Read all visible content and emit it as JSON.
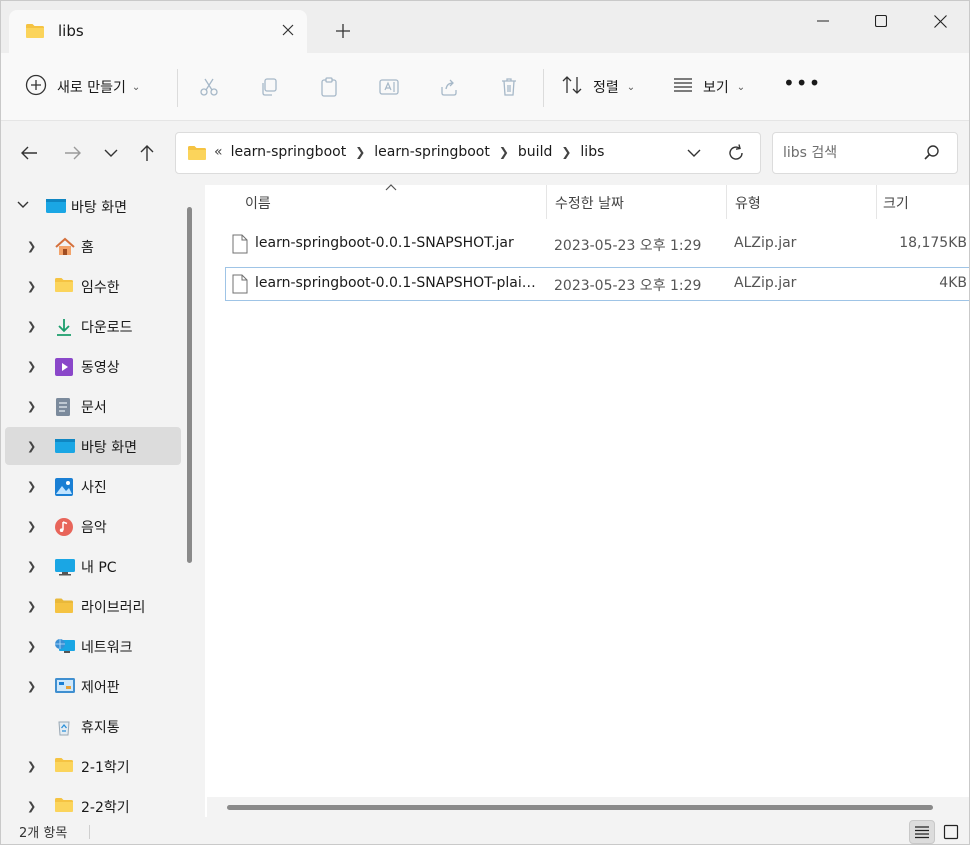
{
  "tab": {
    "title": "libs"
  },
  "toolbar": {
    "new_label": "새로 만들기",
    "sort_label": "정렬",
    "view_label": "보기",
    "more_label": "•••"
  },
  "address": {
    "overflow": "«",
    "crumbs": [
      "learn-springboot",
      "learn-springboot",
      "build",
      "libs"
    ]
  },
  "search": {
    "placeholder": "libs 검색"
  },
  "sidebar": {
    "items": [
      {
        "label": "바탕 화면",
        "icon": "desktop-icon",
        "expanded": true
      },
      {
        "label": "홈",
        "icon": "home-icon"
      },
      {
        "label": "임수한",
        "icon": "folder-icon"
      },
      {
        "label": "다운로드",
        "icon": "download-icon"
      },
      {
        "label": "동영상",
        "icon": "video-icon"
      },
      {
        "label": "문서",
        "icon": "document-icon"
      },
      {
        "label": "바탕 화면",
        "icon": "desktop-icon",
        "selected": true
      },
      {
        "label": "사진",
        "icon": "pictures-icon"
      },
      {
        "label": "음악",
        "icon": "music-icon"
      },
      {
        "label": "내 PC",
        "icon": "computer-icon"
      },
      {
        "label": "라이브러리",
        "icon": "library-icon"
      },
      {
        "label": "네트워크",
        "icon": "network-icon"
      },
      {
        "label": "제어판",
        "icon": "control-panel-icon"
      },
      {
        "label": "휴지통",
        "icon": "recycle-bin-icon"
      },
      {
        "label": "2-1학기",
        "icon": "folder-icon"
      },
      {
        "label": "2-2학기",
        "icon": "folder-icon"
      }
    ]
  },
  "columns": {
    "name": "이름",
    "date": "수정한 날짜",
    "type": "유형",
    "size": "크기"
  },
  "files": [
    {
      "name": "learn-springboot-0.0.1-SNAPSHOT.jar",
      "date": "2023-05-23 오후 1:29",
      "type": "ALZip.jar",
      "size": "18,175KB"
    },
    {
      "name": "learn-springboot-0.0.1-SNAPSHOT-plain...",
      "date": "2023-05-23 오후 1:29",
      "type": "ALZip.jar",
      "size": "4KB"
    }
  ],
  "status": {
    "count": "2개 항목"
  },
  "colors": {
    "accent": "#0067c0",
    "folder": "#f5c342",
    "selected": "#dcdcdc"
  }
}
